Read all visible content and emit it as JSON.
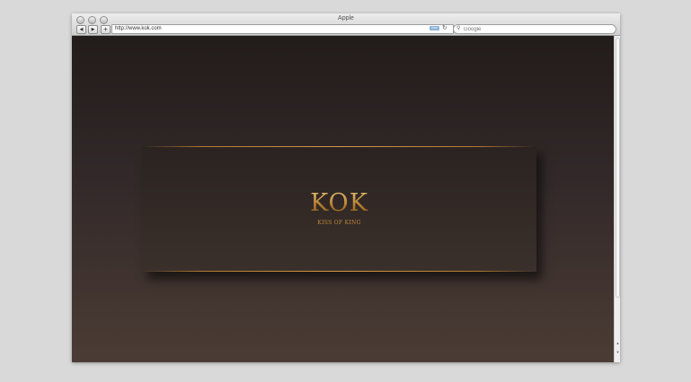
{
  "window": {
    "title": "Apple"
  },
  "toolbar": {
    "back_icon": "◀",
    "forward_icon": "▶",
    "add_icon": "+",
    "url": "http://www.kok.com",
    "rss_label": "RSS",
    "reload_icon": "↻"
  },
  "search": {
    "placeholder": "Google",
    "icon": "magnifier-icon"
  },
  "page": {
    "logo": "KOK",
    "tagline": "KISS OF KING"
  },
  "colors": {
    "accent_gold": "#c8922f",
    "background_dark": "#221c1a",
    "background_bottom": "#4b3c34"
  }
}
